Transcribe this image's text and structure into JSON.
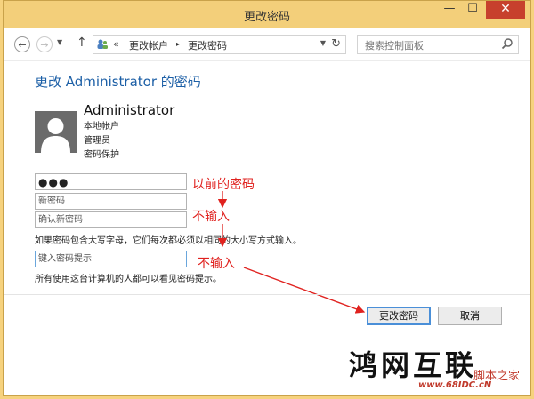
{
  "window": {
    "title": "更改密码",
    "minimize": "—",
    "maximize": "☐",
    "close": "✕"
  },
  "address": {
    "back": "←",
    "forward": "→",
    "up": "↑",
    "crumb_sep": "«",
    "crumbs": [
      "更改帐户",
      "更改密码"
    ],
    "crumb_arrow": "▸",
    "refresh": "↻",
    "search_placeholder": "搜索控制面板"
  },
  "page": {
    "title": "更改 Administrator 的密码",
    "user": {
      "name": "Administrator",
      "info": [
        "本地帐户",
        "管理员",
        "密码保护"
      ]
    },
    "fields": {
      "old_password_value": "●●●",
      "new_password_placeholder": "新密码",
      "confirm_placeholder": "确认新密码",
      "hint_placeholder": "键入密码提示"
    },
    "case_note": "如果密码包含大写字母，它们每次都必须以相同的大小写方式输入。",
    "hint_note": "所有使用这台计算机的人都可以看见密码提示。",
    "buttons": {
      "ok": "更改密码",
      "cancel": "取消"
    }
  },
  "annotations": {
    "old": "以前的密码",
    "no_input_1": "不输入",
    "no_input_2": "不输入",
    "color": "#e0221f"
  },
  "watermark": {
    "main": "鸿网互联",
    "side": "脚本之家",
    "url": "www.68IDC.cN"
  }
}
